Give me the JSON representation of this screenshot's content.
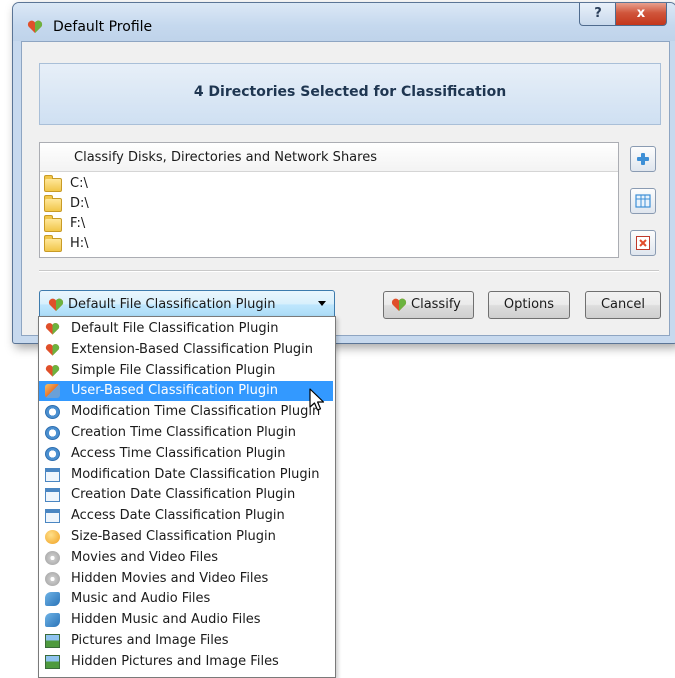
{
  "window": {
    "title": "Default Profile",
    "help_glyph": "?",
    "close_glyph": "x"
  },
  "banner": {
    "text": "4 Directories Selected for Classification"
  },
  "dirlist": {
    "header": "Classify Disks, Directories and Network Shares",
    "items": [
      {
        "label": "C:\\"
      },
      {
        "label": "D:\\"
      },
      {
        "label": "F:\\"
      },
      {
        "label": "H:\\"
      }
    ]
  },
  "combo": {
    "value": "Default File Classification Plugin"
  },
  "buttons": {
    "classify": "Classify",
    "options": "Options",
    "cancel": "Cancel"
  },
  "dropdown": {
    "selected_index": 3,
    "items": [
      {
        "label": "Default File Classification Plugin",
        "icon": "heart-icon"
      },
      {
        "label": "Extension-Based Classification Plugin",
        "icon": "heart-icon"
      },
      {
        "label": "Simple File Classification Plugin",
        "icon": "heart-icon"
      },
      {
        "label": "User-Based Classification Plugin",
        "icon": "user-icon"
      },
      {
        "label": "Modification Time Classification Plugin",
        "icon": "clock-icon"
      },
      {
        "label": "Creation Time Classification Plugin",
        "icon": "clock-icon"
      },
      {
        "label": "Access Time Classification Plugin",
        "icon": "clock-icon"
      },
      {
        "label": "Modification Date Classification Plugin",
        "icon": "calendar-icon"
      },
      {
        "label": "Creation Date Classification Plugin",
        "icon": "calendar-icon"
      },
      {
        "label": "Access Date Classification Plugin",
        "icon": "calendar-icon"
      },
      {
        "label": "Size-Based Classification Plugin",
        "icon": "box-icon"
      },
      {
        "label": "Movies and Video Files",
        "icon": "disc-icon"
      },
      {
        "label": "Hidden Movies and Video Files",
        "icon": "disc-icon"
      },
      {
        "label": "Music and Audio Files",
        "icon": "music-icon"
      },
      {
        "label": "Hidden Music and Audio Files",
        "icon": "music-icon"
      },
      {
        "label": "Pictures and Image Files",
        "icon": "picture-icon"
      },
      {
        "label": "Hidden Pictures and Image Files",
        "icon": "picture-icon"
      }
    ]
  },
  "colors": {
    "accent": "#3399ff",
    "banner_text": "#1f3651",
    "close_button": "#c4361b"
  }
}
